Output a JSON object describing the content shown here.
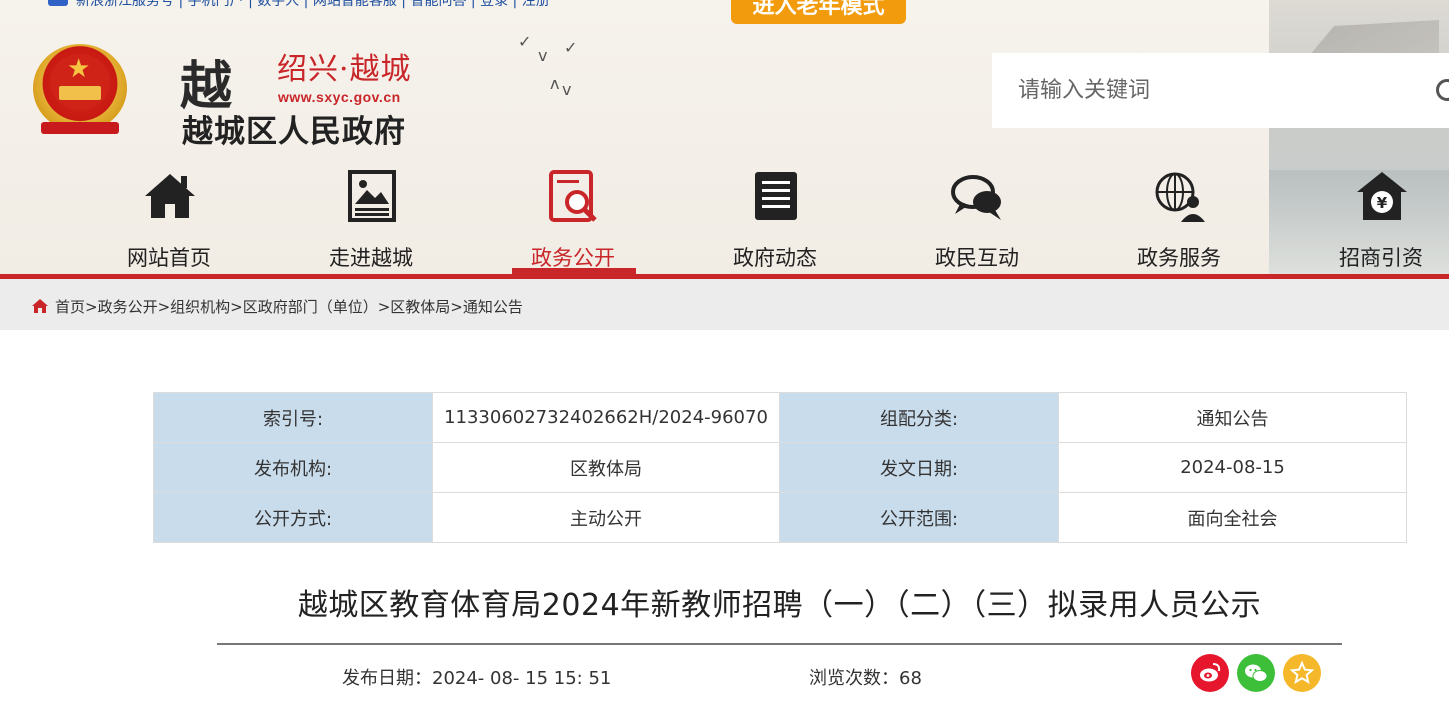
{
  "topbar": {
    "links_text": "新浪浙江服务号  |  手机门户  |  数字人  |  网站智能客服  |  智能问答  |  登录  |  注册",
    "elder_mode": "进入老年模式"
  },
  "header": {
    "logo_glyph": "越",
    "city_name": "绍兴·越城",
    "url": "www.sxyc.gov.cn",
    "gov_name": "越城区人民政府"
  },
  "search": {
    "placeholder": "请输入关键词"
  },
  "nav": {
    "items": [
      {
        "label": "网站首页",
        "icon": "home-icon"
      },
      {
        "label": "走进越城",
        "icon": "picture-icon"
      },
      {
        "label": "政务公开",
        "icon": "document-search-icon",
        "active": true
      },
      {
        "label": "政府动态",
        "icon": "news-icon"
      },
      {
        "label": "政民互动",
        "icon": "chat-bubbles-icon"
      },
      {
        "label": "政务服务",
        "icon": "globe-user-icon"
      },
      {
        "label": "招商引资",
        "icon": "yuan-house-icon"
      }
    ]
  },
  "breadcrumb": {
    "path": "首页>政务公开>组织机构>区政府部门（单位）>区教体局>通知公告"
  },
  "meta": {
    "rows": [
      {
        "k1": "索引号:",
        "v1": "11330602732402662H/2024-96070",
        "k2": "组配分类:",
        "v2": "通知公告"
      },
      {
        "k1": "发布机构:",
        "v1": "区教体局",
        "k2": "发文日期:",
        "v2": "2024-08-15"
      },
      {
        "k1": "公开方式:",
        "v1": "主动公开",
        "k2": "公开范围:",
        "v2": "面向全社会"
      }
    ]
  },
  "article": {
    "title": "越城区教育体育局2024年新教师招聘（一）（二）（三）拟录用人员公示",
    "pub_date_label": "发布日期：",
    "pub_date": "2024- 08- 15 15: 51",
    "views_label": "浏览次数：",
    "views": "68"
  },
  "colors": {
    "brand_red": "#c9262a",
    "elder_orange": "#f29b0c",
    "meta_key_bg": "#c9dcec"
  }
}
